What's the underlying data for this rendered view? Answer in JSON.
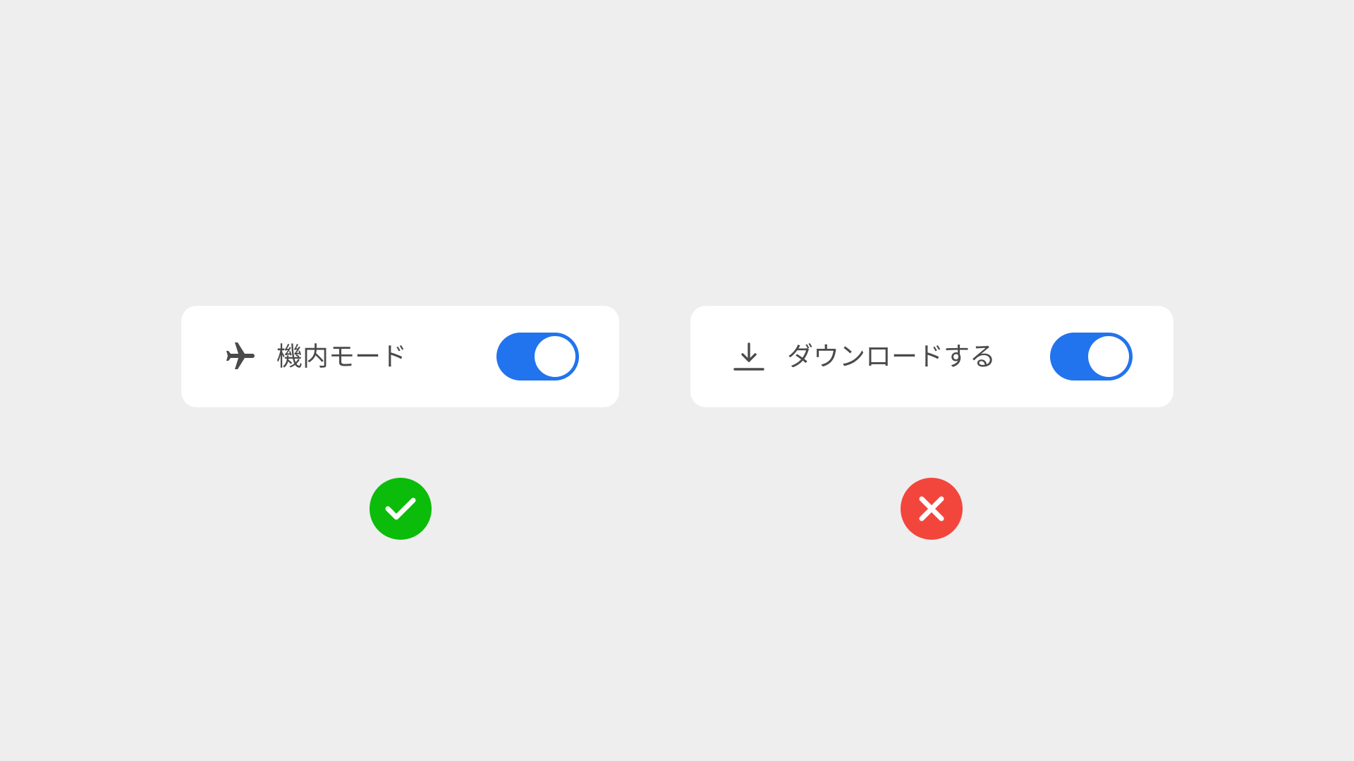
{
  "examples": [
    {
      "id": "good",
      "icon": "airplane-icon",
      "label": "機内モード",
      "toggle_on": true,
      "verdict": "check-icon",
      "verdict_color": "#0cbc0a"
    },
    {
      "id": "bad",
      "icon": "download-icon",
      "label": "ダウンロードする",
      "toggle_on": true,
      "verdict": "cross-icon",
      "verdict_color": "#f2463d"
    }
  ],
  "colors": {
    "background": "#eeeeee",
    "card": "#ffffff",
    "toggle_on": "#2273ee",
    "text": "#4a4a4a",
    "icon": "#4a4a4a"
  }
}
